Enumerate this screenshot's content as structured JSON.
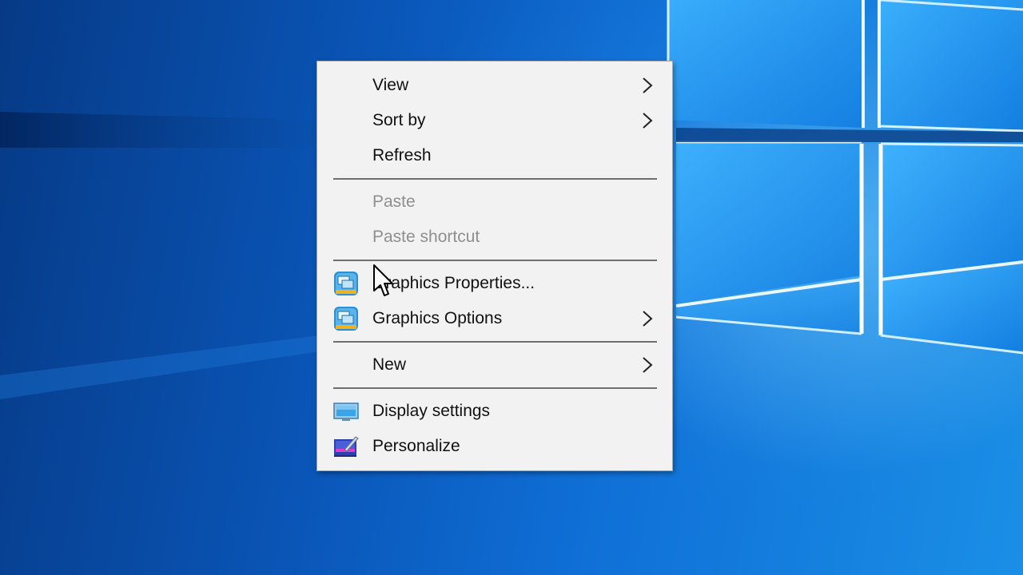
{
  "desktop": {
    "accent_color": "#0a56b8"
  },
  "context_menu": {
    "items": [
      {
        "label": "View",
        "submenu": true,
        "enabled": true,
        "icon": ""
      },
      {
        "label": "Sort by",
        "submenu": true,
        "enabled": true,
        "icon": ""
      },
      {
        "label": "Refresh",
        "submenu": false,
        "enabled": true,
        "icon": ""
      },
      {
        "label": "Paste",
        "submenu": false,
        "enabled": false,
        "icon": ""
      },
      {
        "label": "Paste shortcut",
        "submenu": false,
        "enabled": false,
        "icon": ""
      },
      {
        "label": "Graphics Properties...",
        "submenu": false,
        "enabled": true,
        "icon": "intel-graphics-icon"
      },
      {
        "label": "Graphics Options",
        "submenu": true,
        "enabled": true,
        "icon": "intel-graphics-icon"
      },
      {
        "label": "New",
        "submenu": true,
        "enabled": true,
        "icon": ""
      },
      {
        "label": "Display settings",
        "submenu": false,
        "enabled": true,
        "icon": "display-settings-icon"
      },
      {
        "label": "Personalize",
        "submenu": false,
        "enabled": true,
        "icon": "personalize-icon"
      }
    ],
    "disabled_text_color": "#8f8f8f",
    "background_color": "#f2f2f2"
  },
  "cursor": {
    "icon": "mouse-pointer-icon"
  }
}
